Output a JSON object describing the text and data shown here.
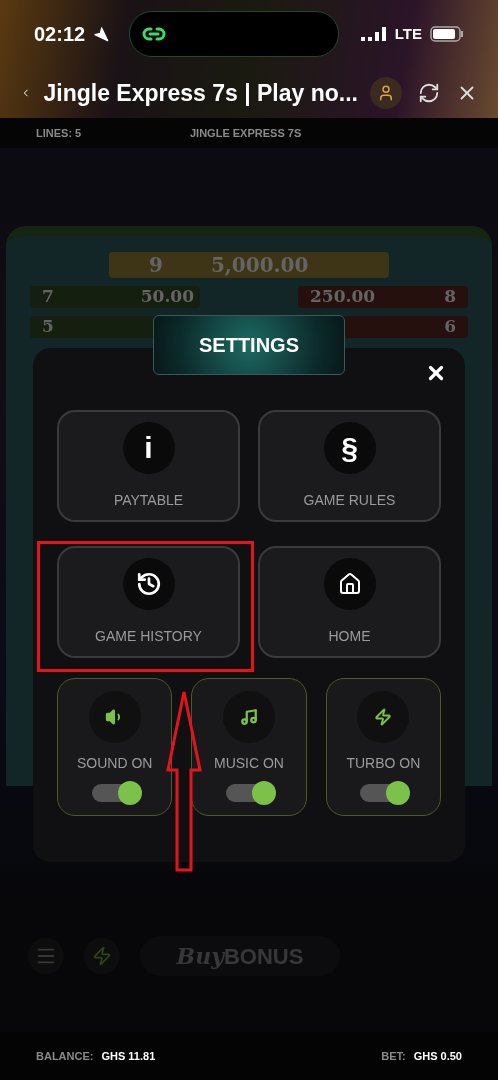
{
  "status_bar": {
    "time": "02:12",
    "network": "LTE"
  },
  "header": {
    "title": "Jingle Express 7s | Play no..."
  },
  "info_bar": {
    "lines": "LINES: 5",
    "game_name": "JINGLE EXPRESS 7S"
  },
  "paytable": {
    "top": {
      "count": "9",
      "amount": "5,000.00"
    },
    "rows": [
      {
        "left_count": "7",
        "left_amount": "50.00",
        "right_amount": "250.00",
        "right_count": "8"
      },
      {
        "left_count": "5",
        "left_amount": "",
        "right_amount": "",
        "right_count": "6"
      }
    ]
  },
  "settings": {
    "title": "SETTINGS",
    "buttons": [
      {
        "label": "PAYTABLE",
        "kind": "glyph",
        "glyph": "i",
        "highlighted": false
      },
      {
        "label": "GAME RULES",
        "kind": "glyph",
        "glyph": "§",
        "highlighted": false
      },
      {
        "label": "GAME HISTORY",
        "kind": "history",
        "highlighted": true
      },
      {
        "label": "HOME",
        "kind": "home",
        "highlighted": false
      }
    ],
    "toggles": [
      {
        "label": "SOUND ON",
        "kind": "sound",
        "on": true
      },
      {
        "label": "MUSIC ON",
        "kind": "music",
        "on": true
      },
      {
        "label": "TURBO ON",
        "kind": "turbo",
        "on": true
      }
    ]
  },
  "controls": {
    "buy_bonus": {
      "prefix": "Buy",
      "main": "BONUS"
    }
  },
  "footer": {
    "balance_label": "BALANCE:",
    "balance": "GHS 11.81",
    "bet_label": "BET:",
    "bet": "GHS 0.50"
  }
}
